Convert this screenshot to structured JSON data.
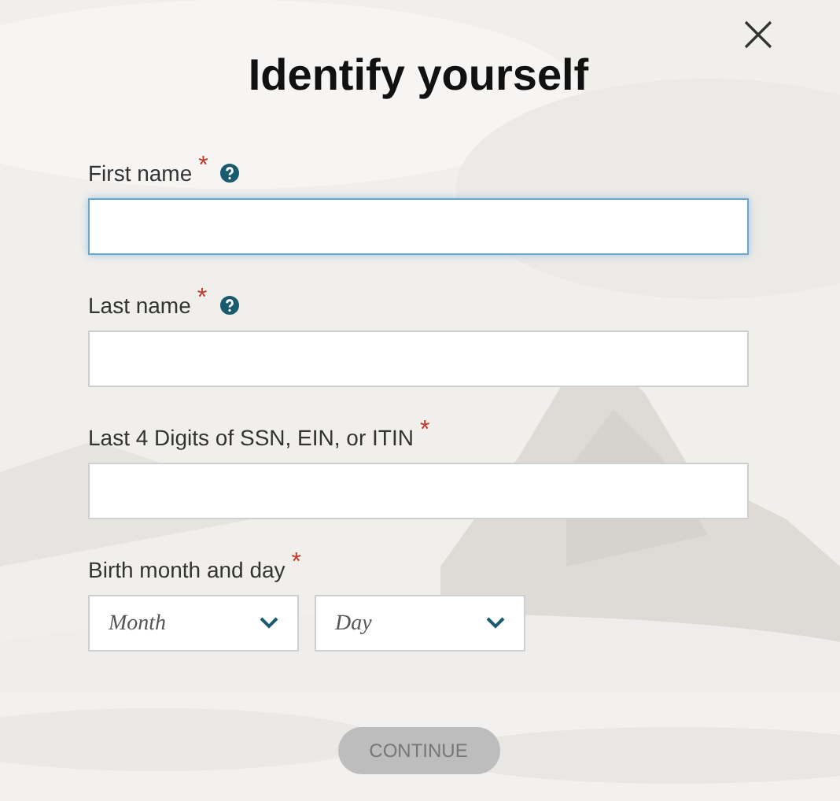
{
  "dialog": {
    "title": "Identify yourself"
  },
  "fields": [
    {
      "label": "First name",
      "required_mark": "*",
      "help": true,
      "focused": true
    },
    {
      "label": "Last name",
      "required_mark": "*",
      "help": true,
      "focused": false
    },
    {
      "label": "Last 4 Digits of SSN, EIN, or ITIN",
      "required_mark": "*",
      "help": false,
      "focused": false
    }
  ],
  "birth": {
    "label": "Birth month and day",
    "required_mark": "*",
    "selects": [
      {
        "placeholder": "Month"
      },
      {
        "placeholder": "Day"
      }
    ]
  },
  "continue_button": {
    "label": "CONTINUE",
    "disabled": true
  }
}
